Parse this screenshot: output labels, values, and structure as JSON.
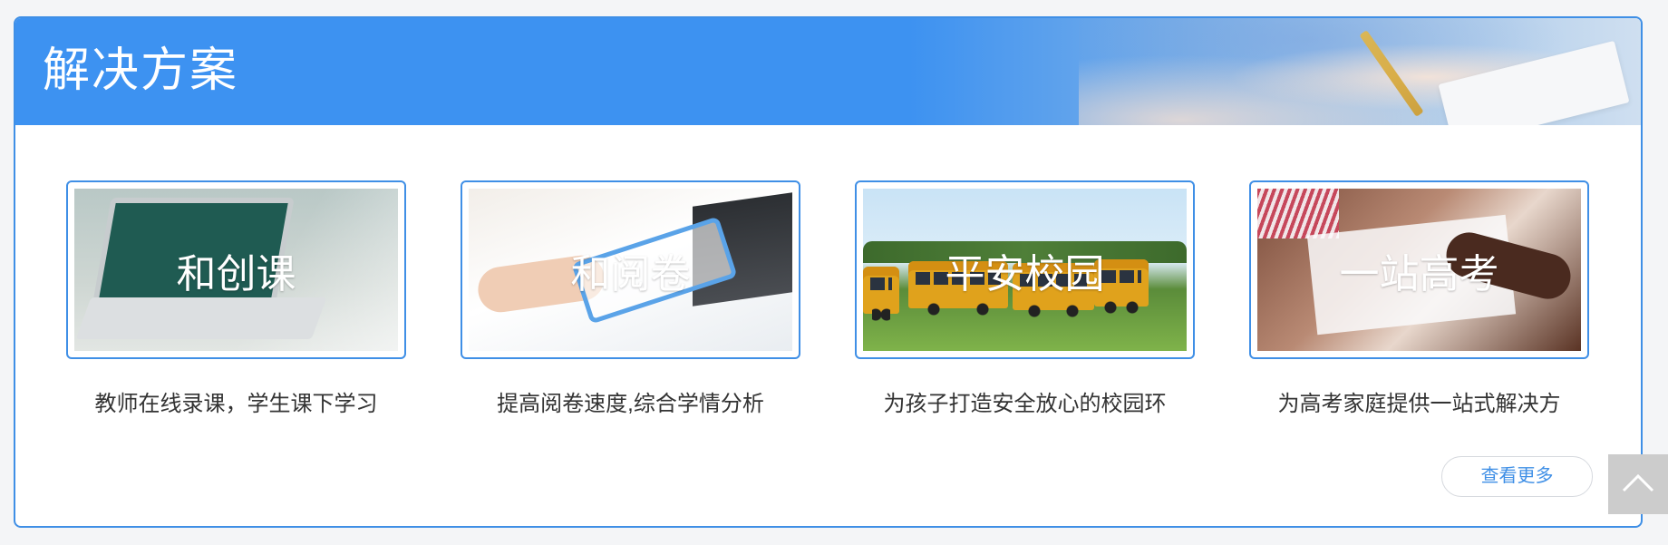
{
  "header": {
    "title": "解决方案"
  },
  "cards": [
    {
      "label": "和创课",
      "description": "教师在线录课，学生课下学习",
      "image": "laptop-classroom"
    },
    {
      "label": "和阅卷",
      "description": "提高阅卷速度,综合学情分析",
      "image": "tablet-grading"
    },
    {
      "label": "平安校园",
      "description": "为孩子打造安全放心的校园环",
      "image": "school-buses"
    },
    {
      "label": "一站高考",
      "description": "为高考家庭提供一站式解决方",
      "image": "exam-writing"
    }
  ],
  "more_button": {
    "label": "查看更多"
  },
  "scroll_top": {
    "icon": "chevron-up-icon"
  },
  "colors": {
    "accent": "#3f8fe6",
    "header_bg": "#3d92f1",
    "page_bg": "#f4f5f7",
    "top_button_bg": "#cccccc"
  }
}
